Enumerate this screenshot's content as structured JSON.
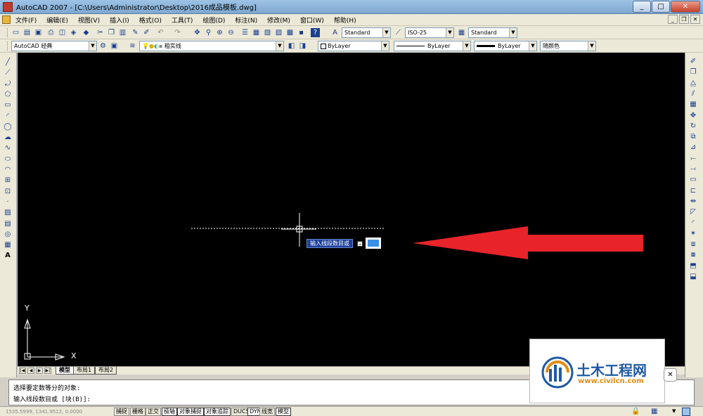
{
  "window": {
    "title": "AutoCAD 2007 - [C:\\Users\\Administrator\\Desktop\\2016成品模板.dwg]"
  },
  "menu": [
    "文件(F)",
    "编辑(E)",
    "视图(V)",
    "插入(I)",
    "格式(O)",
    "工具(T)",
    "绘图(D)",
    "标注(N)",
    "修改(M)",
    "窗口(W)",
    "帮助(H)"
  ],
  "toolbar": {
    "text_style": "Standard",
    "dim_style": "ISO-25",
    "table_style": "Standard",
    "workspace": "AutoCAD 经典",
    "layer": "粗实线",
    "color": "ByLayer",
    "linetype": "ByLayer",
    "lineweight": "ByLayer",
    "plot_style": "随颜色"
  },
  "layout_tabs": [
    "模型",
    "布局1",
    "布局2"
  ],
  "axis_labels": {
    "y": "Y",
    "x": "X"
  },
  "dynamic_input": {
    "prompt": "输入线段数目或"
  },
  "command": {
    "line1": "选择要定数等分的对象:",
    "line2": "输入线段数目或 [块(B)]:"
  },
  "status": {
    "coords": "1535.5999,  1341.9512,  0.0000",
    "buttons": [
      "捕捉",
      "栅格",
      "正交",
      "极轴",
      "对象捕捉",
      "对象追踪",
      "DUCS",
      "DYN",
      "线宽",
      "模型"
    ]
  },
  "watermark": {
    "title": "土木工程网",
    "url": "www.civilcn.com"
  },
  "colors": {
    "arrow": "#e8232a",
    "canvas": "#000000",
    "dyn_bg": "#1d3f9b"
  },
  "icons": {
    "left": [
      "line-icon",
      "construction-line-icon",
      "polyline-icon",
      "polygon-icon",
      "rectangle-icon",
      "arc-icon",
      "circle-icon",
      "revision-cloud-icon",
      "spline-icon",
      "ellipse-icon",
      "ellipse-arc-icon",
      "insert-block-icon",
      "make-block-icon",
      "point-icon",
      "hatch-icon",
      "gradient-icon",
      "region-icon",
      "table-icon",
      "mtext-icon"
    ],
    "right": [
      "erase-icon",
      "copy-icon",
      "mirror-icon",
      "offset-icon",
      "array-icon",
      "move-icon",
      "rotate-icon",
      "scale-icon",
      "stretch-icon",
      "trim-icon",
      "extend-icon",
      "break-at-point-icon",
      "break-icon",
      "join-icon",
      "chamfer-icon",
      "fillet-icon",
      "explode-icon",
      "draworder-front-icon",
      "draworder-back-icon",
      "draworder-above-icon",
      "draworder-under-icon"
    ]
  }
}
